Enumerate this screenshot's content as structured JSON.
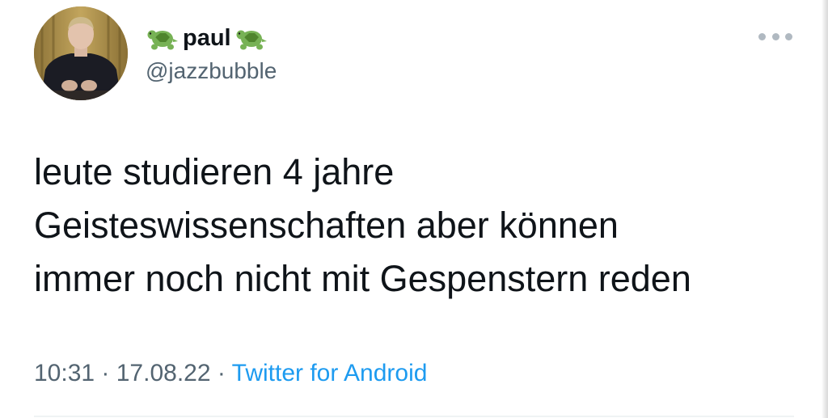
{
  "user": {
    "display_name": "paul",
    "handle": "@jazzbubble",
    "name_icons": [
      "turtle-icon",
      "turtle-icon"
    ]
  },
  "tweet": {
    "lines": [
      "leute studieren 4 jahre",
      "Geisteswissenschaften aber können",
      "immer noch nicht mit Gespenstern reden"
    ]
  },
  "meta": {
    "time": "10:31",
    "separator": " · ",
    "date": "17.08.22",
    "source": "Twitter for Android"
  },
  "icons": {
    "more": "more-horizontal-icon"
  },
  "colors": {
    "text_primary": "#0f1419",
    "text_secondary": "#536471",
    "link": "#1d9bf0",
    "more_dots": "#b0b9c1",
    "divider": "#eff3f4"
  }
}
